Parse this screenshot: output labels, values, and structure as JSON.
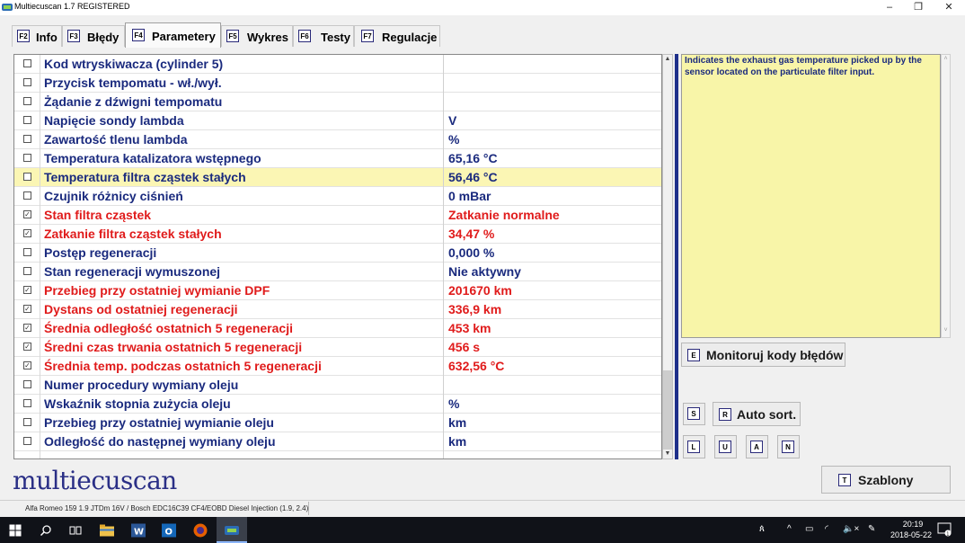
{
  "window": {
    "title": "Multiecuscan 1.7 REGISTERED",
    "minimize": "–",
    "restore": "❐",
    "close": "✕"
  },
  "tabs": [
    {
      "key": "F2",
      "label": "Info"
    },
    {
      "key": "F3",
      "label": "Błędy"
    },
    {
      "key": "F4",
      "label": "Parametery"
    },
    {
      "key": "F5",
      "label": "Wykres"
    },
    {
      "key": "F6",
      "label": "Testy"
    },
    {
      "key": "F7",
      "label": "Regulacje"
    }
  ],
  "rows": [
    {
      "name": "Kod wtryskiwacza (cylinder 5)",
      "value": "",
      "checked": false,
      "red": false
    },
    {
      "name": "Przycisk tempomatu - wł./wył.",
      "value": "",
      "checked": false,
      "red": false
    },
    {
      "name": "Żądanie z dźwigni tempomatu",
      "value": "",
      "checked": false,
      "red": false
    },
    {
      "name": "Napięcie sondy lambda",
      "value": "V",
      "checked": false,
      "red": false
    },
    {
      "name": "Zawartość tlenu lambda",
      "value": "%",
      "checked": false,
      "red": false
    },
    {
      "name": "Temperatura katalizatora wstępnego",
      "value": "65,16 °C",
      "checked": false,
      "red": false
    },
    {
      "name": "Temperatura filtra cząstek stałych",
      "value": "56,46 °C",
      "checked": false,
      "red": false,
      "selected": true
    },
    {
      "name": "Czujnik różnicy ciśnień",
      "value": "0 mBar",
      "checked": false,
      "red": false
    },
    {
      "name": "Stan filtra cząstek",
      "value": "Zatkanie normalne",
      "checked": true,
      "red": true
    },
    {
      "name": "Zatkanie filtra cząstek stałych",
      "value": "34,47 %",
      "checked": true,
      "red": true
    },
    {
      "name": "Postęp regeneracji",
      "value": "0,000 %",
      "checked": false,
      "red": false
    },
    {
      "name": "Stan regeneracji wymuszonej",
      "value": "Nie aktywny",
      "checked": false,
      "red": false
    },
    {
      "name": "Przebieg przy ostatniej wymianie DPF",
      "value": "201670 km",
      "checked": true,
      "red": true
    },
    {
      "name": "Dystans od ostatniej regeneracji",
      "value": "336,9 km",
      "checked": true,
      "red": true
    },
    {
      "name": "Średnia odległość ostatnich 5 regeneracji",
      "value": "453 km",
      "checked": true,
      "red": true
    },
    {
      "name": "Średni czas trwania ostatnich 5 regeneracji",
      "value": "456 s",
      "checked": true,
      "red": true
    },
    {
      "name": "Średnia temp. podczas ostatnich 5 regeneracji",
      "value": "632,56 °C",
      "checked": true,
      "red": true
    },
    {
      "name": "Numer procedury wymiany oleju",
      "value": "",
      "checked": false,
      "red": false
    },
    {
      "name": "Wskaźnik stopnia zużycia oleju",
      "value": "%",
      "checked": false,
      "red": false
    },
    {
      "name": "Przebieg przy ostatniej wymianie oleju",
      "value": "km",
      "checked": false,
      "red": false
    },
    {
      "name": "Odległość do następnej wymiany oleju",
      "value": "km",
      "checked": false,
      "red": false
    }
  ],
  "description": "Indicates the exhaust gas temperature picked up by the sensor located on the particulate filter input.",
  "buttons": {
    "monitor": {
      "key": "E",
      "label": "Monitoruj kody błędów"
    },
    "s": {
      "key": "S"
    },
    "autosort": {
      "key": "R",
      "label": "Auto sort."
    },
    "l": {
      "key": "L"
    },
    "u": {
      "key": "U"
    },
    "a": {
      "key": "A"
    },
    "n": {
      "key": "N"
    },
    "templates": {
      "key": "T",
      "label": "Szablony"
    }
  },
  "logo": "multiecuscan",
  "status": "Alfa Romeo 159 1.9 JTDm 16V / Bosch EDC16C39 CF4/EOBD Diesel Injection (1.9, 2.4)",
  "taskbar": {
    "time": "20:19",
    "date": "2018-05-22",
    "tray_lang": "🔈×"
  },
  "colors": {
    "name_blue": "#1a2a7e",
    "alert_red": "#e01b1b",
    "selected_row": "#fbf6b4",
    "description_bg": "#f8f5a8"
  }
}
